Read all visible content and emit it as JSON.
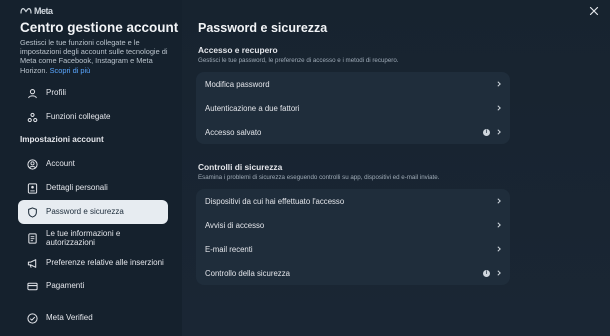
{
  "brand": {
    "logo_text": "Meta"
  },
  "sidebar": {
    "title": "Centro gestione account",
    "description": "Gestisci le tue funzioni collegate e le impostazioni degli account sulle tecnologie di Meta come Facebook, Instagram e Meta Horizon.",
    "learn_more": "Scopri di più",
    "top_items": [
      {
        "label": "Profili",
        "icon": "person-icon"
      },
      {
        "label": "Funzioni collegate",
        "icon": "connected-icon"
      }
    ],
    "section_label": "Impostazioni account",
    "items": [
      {
        "label": "Account",
        "icon": "account-circle-icon"
      },
      {
        "label": "Dettagli personali",
        "icon": "id-card-icon"
      },
      {
        "label": "Password e sicurezza",
        "icon": "shield-icon",
        "active": true
      },
      {
        "label": "Le tue informazioni e autorizzazioni",
        "icon": "info-doc-icon"
      },
      {
        "label": "Preferenze relative alle inserzioni",
        "icon": "megaphone-icon"
      },
      {
        "label": "Pagamenti",
        "icon": "credit-card-icon"
      }
    ],
    "bottom_item": {
      "label": "Meta Verified",
      "icon": "verified-badge-icon"
    }
  },
  "main": {
    "title": "Password e sicurezza",
    "groups": [
      {
        "title": "Accesso e recupero",
        "description": "Gestisci le tue password, le preferenze di accesso e i metodi di recupero.",
        "rows": [
          {
            "label": "Modifica password",
            "info": false
          },
          {
            "label": "Autenticazione a due fattori",
            "info": false
          },
          {
            "label": "Accesso salvato",
            "info": true
          }
        ]
      },
      {
        "title": "Controlli di sicurezza",
        "description": "Esamina i problemi di sicurezza eseguendo controlli su app, dispositivi ed e-mail inviate.",
        "rows": [
          {
            "label": "Dispositivi da cui hai effettuato l'accesso",
            "info": false
          },
          {
            "label": "Avvisi di accesso",
            "info": false
          },
          {
            "label": "E-mail recenti",
            "info": false
          },
          {
            "label": "Controllo della sicurezza",
            "info": true
          }
        ]
      }
    ]
  },
  "colors": {
    "accent_link": "#5aa7ff",
    "active_bg": "#e7ecf1",
    "card_bg": "#1f2d3b",
    "bg": "#17232f"
  }
}
